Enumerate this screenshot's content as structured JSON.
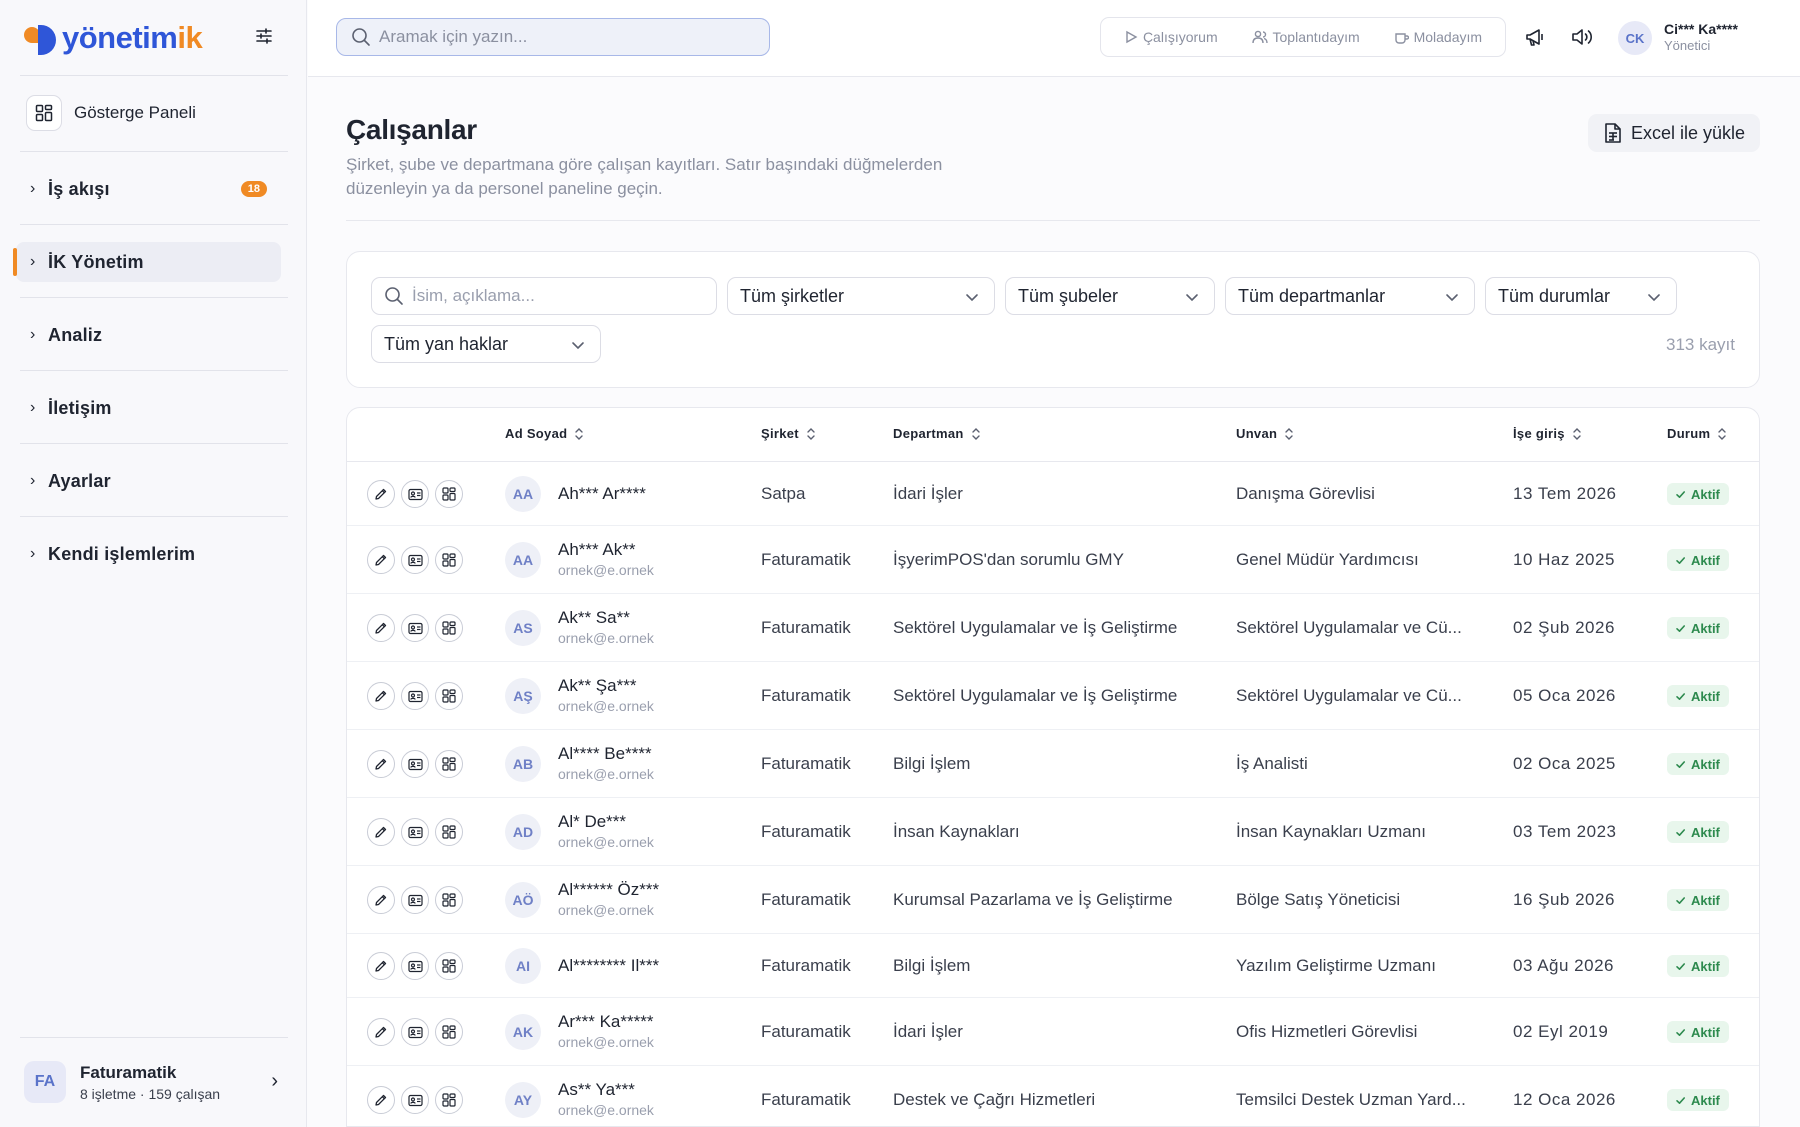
{
  "app": {
    "logo_main": "yönetim",
    "logo_accent": "ik"
  },
  "sidebar": {
    "dashboard_label": "Gösterge Paneli",
    "items": [
      {
        "label": "İş akışı",
        "badge": "18"
      },
      {
        "label": "İK Yönetim",
        "active": true
      },
      {
        "label": "Analiz"
      },
      {
        "label": "İletişim"
      },
      {
        "label": "Ayarlar"
      },
      {
        "label": "Kendi işlemlerim"
      }
    ],
    "org": {
      "initials": "FA",
      "name": "Faturamatik",
      "sub": "8 işletme · 159 çalışan"
    }
  },
  "topbar": {
    "search_placeholder": "Aramak için yazın...",
    "status": {
      "working": "Çalışıyorum",
      "meeting": "Toplantıdayım",
      "break": "Moladayım"
    },
    "user": {
      "initials": "CK",
      "name": "Ci*** Ka****",
      "role": "Yönetici"
    }
  },
  "page": {
    "title": "Çalışanlar",
    "description": "Şirket, şube ve departmana göre çalışan kayıtları. Satır başındaki düğmelerden düzenleyin ya da personel paneline geçin.",
    "excel_label": "Excel ile yükle"
  },
  "filters": {
    "search_placeholder": "İsim, açıklama...",
    "company": "Tüm şirketler",
    "branch": "Tüm şubeler",
    "department": "Tüm departmanlar",
    "status": "Tüm durumlar",
    "benefits": "Tüm yan haklar",
    "record_count": "313 kayıt"
  },
  "table": {
    "headers": {
      "name": "Ad Soyad",
      "company": "Şirket",
      "department": "Departman",
      "title": "Unvan",
      "start": "İşe giriş",
      "status": "Durum"
    },
    "rows": [
      {
        "initials": "AA",
        "name": "Ah*** Ar****",
        "email": "",
        "company": "Satpa",
        "department": "İdari İşler",
        "title": "Danışma Görevlisi",
        "start": "13 Tem 2026",
        "status": "Aktif"
      },
      {
        "initials": "AA",
        "name": "Ah*** Ak**",
        "email": "ornek@e.ornek",
        "company": "Faturamatik",
        "department": "İşyerimPOS'dan sorumlu GMY",
        "title": "Genel Müdür Yardımcısı",
        "start": "10 Haz 2025",
        "status": "Aktif"
      },
      {
        "initials": "AS",
        "name": "Ak** Sa**",
        "email": "ornek@e.ornek",
        "company": "Faturamatik",
        "department": "Sektörel Uygulamalar ve İş Geliştirme",
        "title": "Sektörel Uygulamalar ve Cü...",
        "start": "02 Şub 2026",
        "status": "Aktif"
      },
      {
        "initials": "AŞ",
        "name": "Ak** Şa***",
        "email": "ornek@e.ornek",
        "company": "Faturamatik",
        "department": "Sektörel Uygulamalar ve İş Geliştirme",
        "title": "Sektörel Uygulamalar ve Cü...",
        "start": "05 Oca 2026",
        "status": "Aktif"
      },
      {
        "initials": "AB",
        "name": "Al**** Be****",
        "email": "ornek@e.ornek",
        "company": "Faturamatik",
        "department": "Bilgi İşlem",
        "title": "İş Analisti",
        "start": "02 Oca 2025",
        "status": "Aktif"
      },
      {
        "initials": "AD",
        "name": "Al* De***",
        "email": "ornek@e.ornek",
        "company": "Faturamatik",
        "department": "İnsan Kaynakları",
        "title": "İnsan Kaynakları Uzmanı",
        "start": "03 Tem 2023",
        "status": "Aktif"
      },
      {
        "initials": "AÖ",
        "name": "Al****** Öz***",
        "email": "ornek@e.ornek",
        "company": "Faturamatik",
        "department": "Kurumsal Pazarlama ve İş Geliştirme",
        "title": "Bölge Satış Yöneticisi",
        "start": "16 Şub 2026",
        "status": "Aktif"
      },
      {
        "initials": "AI",
        "name": "Al******** Il***",
        "email": "",
        "company": "Faturamatik",
        "department": "Bilgi İşlem",
        "title": "Yazılım Geliştirme Uzmanı",
        "start": "03 Ağu 2026",
        "status": "Aktif"
      },
      {
        "initials": "AK",
        "name": "Ar*** Ka*****",
        "email": "ornek@e.ornek",
        "company": "Faturamatik",
        "department": "İdari İşler",
        "title": "Ofis Hizmetleri Görevlisi",
        "start": "02 Eyl 2019",
        "status": "Aktif"
      },
      {
        "initials": "AY",
        "name": "As** Ya***",
        "email": "ornek@e.ornek",
        "company": "Faturamatik",
        "department": "Destek ve Çağrı Hizmetleri",
        "title": "Temsilci Destek Uzman Yard...",
        "start": "12 Oca 2026",
        "status": "Aktif"
      }
    ]
  },
  "colors": {
    "brand_blue": "#2f56d8",
    "brand_orange": "#f08a24",
    "status_green": "#2d8a4e"
  }
}
